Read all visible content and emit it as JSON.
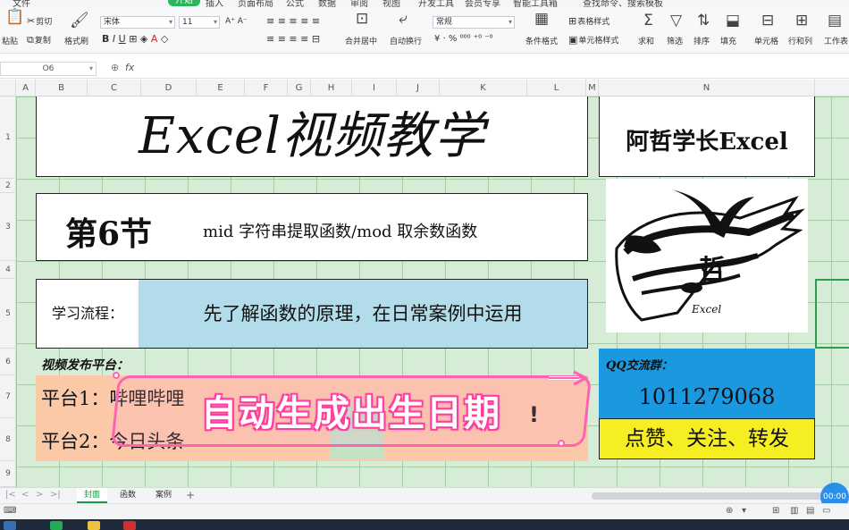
{
  "menubar": {
    "items": [
      "文件",
      "开始",
      "插入",
      "页面布局",
      "公式",
      "数据",
      "审阅",
      "视图",
      "开发工具",
      "会员专享",
      "智能工具箱"
    ],
    "active": "开始",
    "search": "查找命令、搜索模板"
  },
  "ribbon": {
    "cut": "剪切",
    "paste": "粘贴",
    "copy": "复制",
    "format_painter": "格式刷",
    "font_name": "宋体",
    "font_size": "11",
    "merge_center": "合并居中",
    "wrap_text": "自动换行",
    "number_format": "常规",
    "conditional_format": "条件格式",
    "table_style": "表格样式",
    "cell_style": "单元格样式",
    "sum": "求和",
    "filter": "筛选",
    "sort": "排序",
    "fill": "填充",
    "cells": "单元格",
    "rows_cols": "行和列",
    "worksheet": "工作表"
  },
  "formula_bar": {
    "name_box": "O6",
    "fx": "fx",
    "value": ""
  },
  "columns": [
    "A",
    "B",
    "C",
    "D",
    "E",
    "F",
    "G",
    "H",
    "I",
    "J",
    "K",
    "L",
    "M",
    "N"
  ],
  "rows": [
    "1",
    "2",
    "3",
    "4",
    "5",
    "6",
    "7",
    "8",
    "9"
  ],
  "sheet": {
    "title": "Excel视频教学",
    "brand": "阿哲学长Excel",
    "section_num": "第6节",
    "section_desc": "mid 字符串提取函数/mod 取余数函数",
    "flow_label": "学习流程：",
    "flow_content": "先了解函数的原理，在日常案例中运用",
    "platform_head": "视频发布平台：",
    "platform1": "平台1：哔哩哔哩",
    "platform2": "平台2：今日头条",
    "platform_mark": "!",
    "qq_head": "QQ交流群：",
    "qq_num": "1011279068",
    "cta": "点赞、关注、转发"
  },
  "overlay": {
    "banner_text": "自动生成出生日期"
  },
  "tabs": {
    "sheets": [
      "封面",
      "函数",
      "案例"
    ],
    "active": "封面",
    "add": "+"
  },
  "timer": "00:00",
  "colors": {
    "sheet_bg": "#d6ecd6",
    "flow_blue": "#b3dcea",
    "platform_orange": "#fbc9a8",
    "qq_blue": "#1a98e0",
    "cta_yellow": "#f5ee22",
    "banner_pink": "#ff62b3",
    "ribbon_active_green": "#2db55d"
  }
}
